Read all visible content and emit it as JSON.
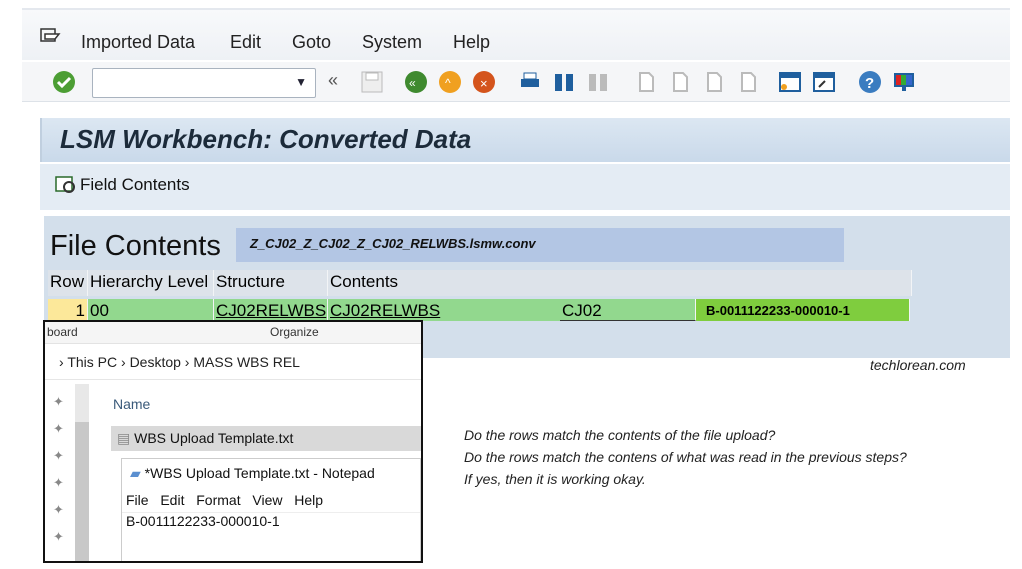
{
  "menu": {
    "items": [
      "Imported Data",
      "Edit",
      "Goto",
      "System",
      "Help"
    ]
  },
  "toolbar": {
    "command_value": "",
    "icons": [
      "enter-icon",
      "back-arrows-icon",
      "save-icon",
      "back-icon",
      "exit-icon",
      "cancel-icon",
      "print-icon",
      "find-icon",
      "find-next-icon",
      "first-page-icon",
      "prev-page-icon",
      "next-page-icon",
      "last-page-icon",
      "new-session-icon",
      "shortcut-icon",
      "help-icon",
      "customize-layout-icon"
    ]
  },
  "title": "LSM Workbench: Converted Data",
  "field_contents_button": "Field Contents",
  "file_contents": {
    "heading": "File Contents",
    "filename": "Z_CJ02_Z_CJ02_Z_CJ02_RELWBS.lsmw.conv",
    "columns": [
      "Row",
      "Hierarchy Level",
      "Structure",
      "Contents"
    ],
    "rows": [
      {
        "row": "1",
        "level": "00",
        "structure": "CJ02RELWBS",
        "contents_a": "CJ02RELWBS",
        "contents_b": "CJ02",
        "contents_c": "B-0011122233-000010-1"
      }
    ]
  },
  "explorer": {
    "ribbon": [
      "board",
      "Organize"
    ],
    "breadcrumb": [
      "This PC",
      "Desktop",
      "MASS WBS REL"
    ],
    "column": "Name",
    "file": "WBS Upload Template.txt",
    "notepad": {
      "title": "*WBS Upload Template.txt - Notepad",
      "menu": [
        "File",
        "Edit",
        "Format",
        "View",
        "Help"
      ],
      "text": "B-0011122233-000010-1"
    }
  },
  "caption": "techlorean.com",
  "notes": [
    "Do the rows match the contents of the file upload?",
    "Do the rows match the contens of what was read in the previous steps?",
    "If yes, then it is working okay."
  ]
}
